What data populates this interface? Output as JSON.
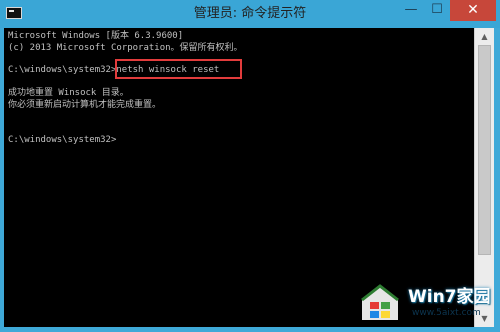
{
  "window": {
    "title": "管理员: 命令提示符",
    "controls": {
      "minimize": "—",
      "maximize": "☐",
      "close": "✕"
    }
  },
  "console": {
    "lines": [
      "Microsoft Windows [版本 6.3.9600]",
      "(c) 2013 Microsoft Corporation。保留所有权利。",
      "C:\\windows\\system32>netsh winsock reset",
      "成功地重置 Winsock 目录。",
      "你必须重新启动计算机才能完成重置。",
      "C:\\windows\\system32>"
    ],
    "highlighted_command": "netsh winsock reset",
    "highlight_color": "#e23c3c"
  },
  "watermark": {
    "title": "Win7家园",
    "url": "www.5aixt.com"
  }
}
